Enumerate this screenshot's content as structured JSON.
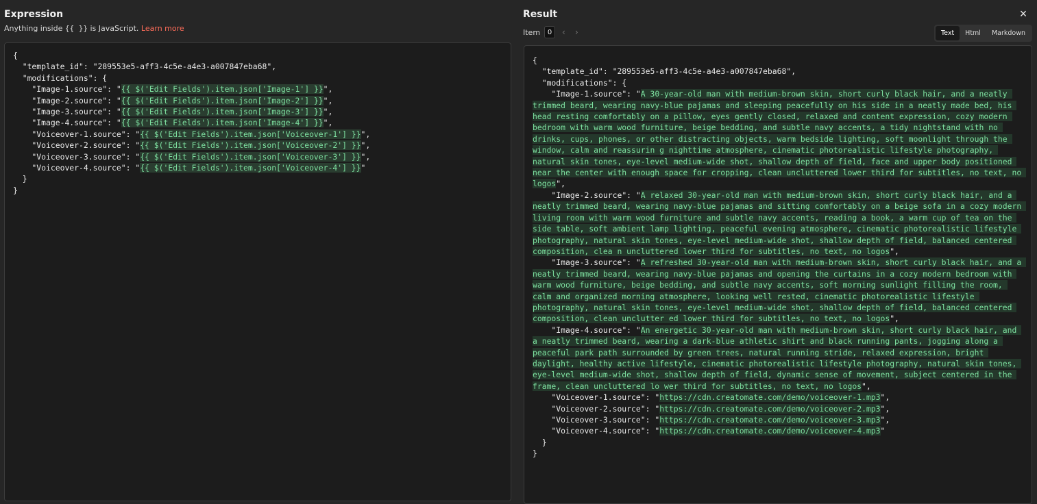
{
  "expression": {
    "title": "Expression",
    "hint_prefix": "Anything inside",
    "hint_braces": "{{ }}",
    "hint_suffix": "is JavaScript.",
    "learn_more": "Learn more",
    "template_id": "289553e5-aff3-4c5e-a4e3-a007847eba68",
    "items": [
      {
        "key": "Image-1.source",
        "expr": "{{ $('Edit Fields').item.json['Image-1'] }}"
      },
      {
        "key": "Image-2.source",
        "expr": "{{ $('Edit Fields').item.json['Image-2'] }}"
      },
      {
        "key": "Image-3.source",
        "expr": "{{ $('Edit Fields').item.json['Image-3'] }}"
      },
      {
        "key": "Image-4.source",
        "expr": "{{ $('Edit Fields').item.json['Image-4'] }}"
      },
      {
        "key": "Voiceover-1.source",
        "expr": "{{ $('Edit Fields').item.json['Voiceover-1'] }}"
      },
      {
        "key": "Voiceover-2.source",
        "expr": "{{ $('Edit Fields').item.json['Voiceover-2'] }}"
      },
      {
        "key": "Voiceover-3.source",
        "expr": "{{ $('Edit Fields').item.json['Voiceover-3'] }}"
      },
      {
        "key": "Voiceover-4.source",
        "expr": "{{ $('Edit Fields').item.json['Voiceover-4'] }}"
      }
    ]
  },
  "result": {
    "title": "Result",
    "item_label": "Item",
    "item_value": "0",
    "prev_icon": "‹",
    "next_icon": "›",
    "tabs": [
      "Text",
      "Html",
      "Markdown"
    ],
    "active_tab": "Text",
    "close_icon": "×",
    "template_id": "289553e5-aff3-4c5e-a4e3-a007847eba68",
    "items": [
      {
        "key": "Image-1.source",
        "value": "A 30-year-old man with medium-brown skin, short curly black hair, and a neatly trimmed beard, wearing navy-blue pajamas and sleeping peacefully on his side in a neatly made bed, his head resting comfortably on a pillow, eyes gently closed, relaxed and content expression, cozy modern bedroom with warm wood furniture, beige bedding, and subtle navy accents, a tidy nightstand with no drinks, cups, phones, or other distracting objects, warm bedside lighting, soft moonlight through the window, calm and reassurin g nighttime atmosphere, cinematic photorealistic lifestyle photography, natural skin tones, eye-level medium-wide shot, shallow depth of field, face and upper body positioned near the center with enough space for cropping, clean uncluttered lower third for subtitles, no text, no logos"
      },
      {
        "key": "Image-2.source",
        "value": "A relaxed 30-year-old man with medium-brown skin, short curly black hair, and a neatly trimmed beard, wearing navy-blue pajamas and sitting comfortably on a beige sofa in a cozy modern living room with warm wood furniture and subtle navy accents, reading a book, a warm cup of tea on the side table, soft ambient lamp lighting, peaceful evening atmosphere, cinematic photorealistic lifestyle photography, natural skin tones, eye-level medium-wide shot, shallow depth of field, balanced centered composition, clea n uncluttered lower third for subtitles, no text, no logos"
      },
      {
        "key": "Image-3.source",
        "value": "A refreshed 30-year-old man with medium-brown skin, short curly black hair, and a neatly trimmed beard, wearing navy-blue pajamas and opening the curtains in a cozy modern bedroom with warm wood furniture, beige bedding, and subtle navy accents, soft morning sunlight filling the room, calm and organized morning atmosphere, looking well rested, cinematic photorealistic lifestyle photography, natural skin tones, eye-level medium-wide shot, shallow depth of field, balanced centered composition, clean unclutter ed lower third for subtitles, no text, no logos"
      },
      {
        "key": "Image-4.source",
        "value": "An energetic 30-year-old man with medium-brown skin, short curly black hair, and a neatly trimmed beard, wearing a dark-blue athletic shirt and black running pants, jogging along a peaceful park path surrounded by green trees, natural running stride, relaxed expression, bright daylight, healthy active lifestyle, cinematic photorealistic lifestyle photography, natural skin tones, eye-level medium-wide shot, shallow depth of field, dynamic sense of movement, subject centered in the frame, clean uncluttered lo wer third for subtitles, no text, no logos"
      },
      {
        "key": "Voiceover-1.source",
        "value": "https://cdn.creatomate.com/demo/voiceover-1.mp3"
      },
      {
        "key": "Voiceover-2.source",
        "value": "https://cdn.creatomate.com/demo/voiceover-2.mp3"
      },
      {
        "key": "Voiceover-3.source",
        "value": "https://cdn.creatomate.com/demo/voiceover-3.mp3"
      },
      {
        "key": "Voiceover-4.source",
        "value": "https://cdn.creatomate.com/demo/voiceover-4.mp3"
      }
    ]
  }
}
